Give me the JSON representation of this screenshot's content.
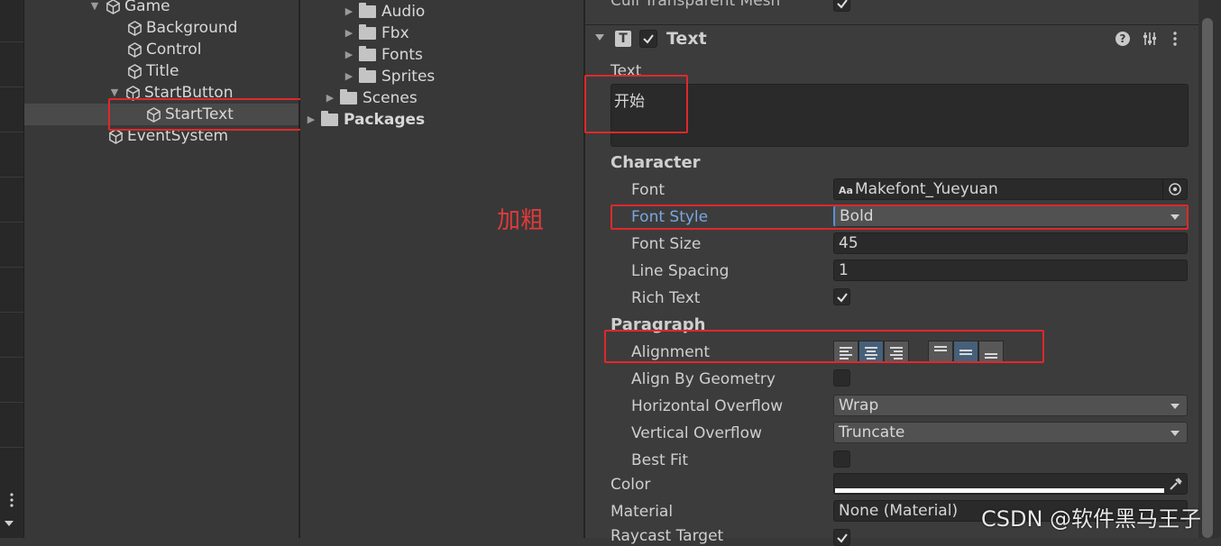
{
  "hierarchy": {
    "items": [
      {
        "label": "Game"
      },
      {
        "label": "Background"
      },
      {
        "label": "Control"
      },
      {
        "label": "Title"
      },
      {
        "label": "StartButton"
      },
      {
        "label": "StartText"
      },
      {
        "label": "EventSystem"
      }
    ]
  },
  "project": {
    "folders": [
      {
        "label": "Audio"
      },
      {
        "label": "Fbx"
      },
      {
        "label": "Fonts"
      },
      {
        "label": "Sprites"
      },
      {
        "label": "Scenes"
      },
      {
        "label": "Packages"
      }
    ]
  },
  "annotation": {
    "label": "加粗",
    "color": "#e0282a"
  },
  "inspector": {
    "cull_label": "Cull Transparent Mesh",
    "component_title": "Text",
    "text_label": "Text",
    "text_value": "开始",
    "character_header": "Character",
    "font_label": "Font",
    "font_value": "Makefont_Yueyuan",
    "font_prefix": "Aa",
    "font_style_label": "Font Style",
    "font_style_value": "Bold",
    "font_size_label": "Font Size",
    "font_size_value": "45",
    "line_spacing_label": "Line Spacing",
    "line_spacing_value": "1",
    "rich_text_label": "Rich Text",
    "paragraph_header": "Paragraph",
    "alignment_label": "Alignment",
    "align_geometry_label": "Align By Geometry",
    "h_overflow_label": "Horizontal Overflow",
    "h_overflow_value": "Wrap",
    "v_overflow_label": "Vertical Overflow",
    "v_overflow_value": "Truncate",
    "best_fit_label": "Best Fit",
    "color_label": "Color",
    "material_label": "Material",
    "material_value": "None (Material)",
    "raycast_label": "Raycast Target"
  },
  "watermark": "CSDN @软件黑马王子",
  "colors": {
    "accent": "#46607a",
    "highlight_label": "#7aa7e0"
  }
}
